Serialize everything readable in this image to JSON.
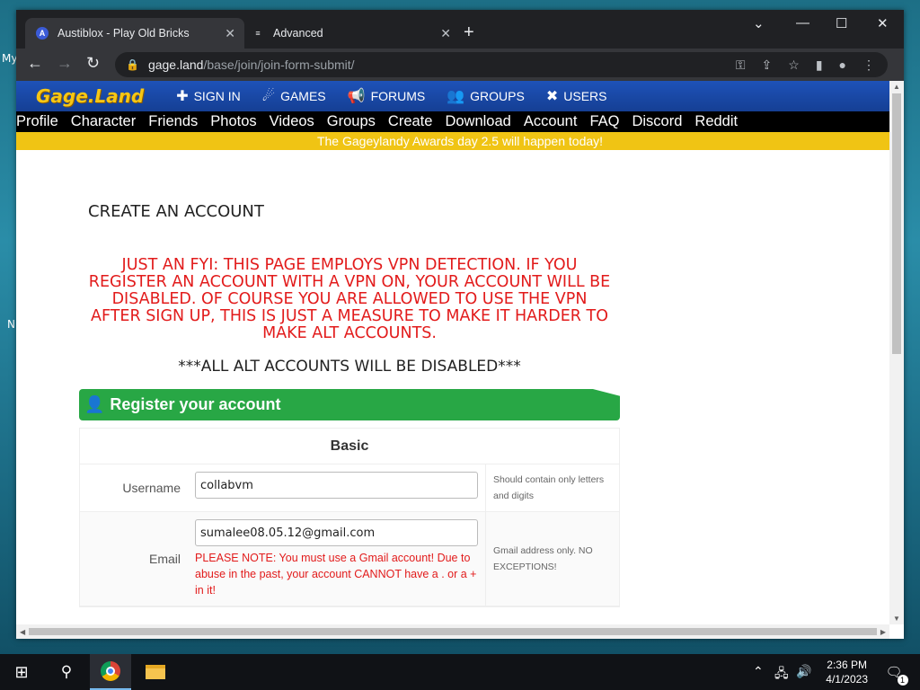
{
  "desktop": {
    "edge_texts": [
      "My",
      "N"
    ]
  },
  "browser": {
    "tabs": [
      {
        "title": "Austiblox - Play Old Bricks",
        "favicon": "A",
        "active": true
      },
      {
        "title": "Advanced",
        "favicon": "≡",
        "active": false
      }
    ],
    "address": {
      "host": "gage.land",
      "path": "/base/join/join-form-submit/"
    }
  },
  "site": {
    "logo": "Gage.Land",
    "nav": [
      {
        "label": "SIGN IN",
        "icon": "puzzle-icon"
      },
      {
        "label": "GAMES",
        "icon": "rocket-icon"
      },
      {
        "label": "FORUMS",
        "icon": "megaphone-icon"
      },
      {
        "label": "GROUPS",
        "icon": "group-icon"
      },
      {
        "label": "USERS",
        "icon": "user-x-icon"
      }
    ],
    "subnav": [
      "Profile",
      "Character",
      "Friends",
      "Photos",
      "Videos",
      "Groups",
      "Create",
      "Download",
      "Account",
      "FAQ",
      "Discord",
      "Reddit"
    ],
    "banner": "The Gageylandy Awards day 2.5 will happen today!"
  },
  "page": {
    "title": "CREATE AN ACCOUNT",
    "vpn_warning": "JUST AN FYI: THIS PAGE EMPLOYS VPN DETECTION. IF YOU REGISTER AN ACCOUNT WITH A VPN ON, YOUR ACCOUNT WILL BE DISABLED. OF COURSE YOU ARE ALLOWED TO USE THE VPN AFTER SIGN UP, THIS IS JUST A MEASURE TO MAKE IT HARDER TO MAKE ALT ACCOUNTS.",
    "alt_warning": "***ALL ALT ACCOUNTS WILL BE DISABLED***",
    "register_header": "Register your account",
    "section": "Basic",
    "fields": {
      "username": {
        "label": "Username",
        "value": "collabvm",
        "help": "Should contain only letters and digits"
      },
      "email": {
        "label": "Email",
        "value": "sumalee08.05.12@gmail.com",
        "note": "PLEASE NOTE: You must use a Gmail account! Due to abuse in the past, your account CANNOT have a . or a + in it!",
        "help": "Gmail address only. NO EXCEPTIONS!"
      }
    }
  },
  "taskbar": {
    "time": "2:36 PM",
    "date": "4/1/2023",
    "notifications": "1"
  },
  "colors": {
    "site_nav": "#1e52b8",
    "banner": "#f0c414",
    "warning": "#e21b1b",
    "register_green": "#28a745"
  }
}
